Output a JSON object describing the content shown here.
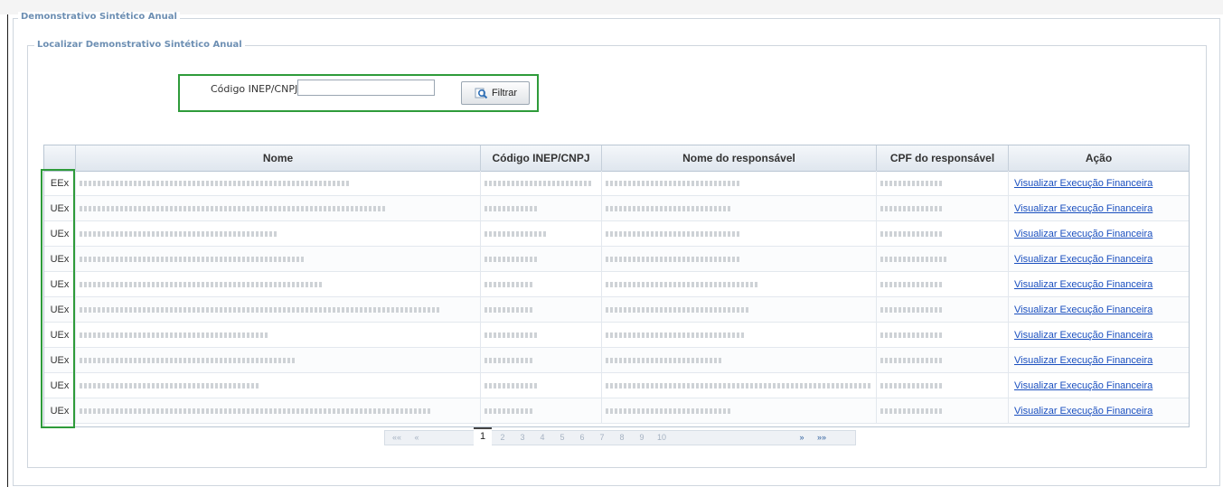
{
  "panel": {
    "title": "Demonstrativo Sintético Anual",
    "section_title": "Localizar Demonstrativo Sintético Anual"
  },
  "filter": {
    "label": "Código INEP/CNPJ",
    "value": "",
    "button_label": "Filtrar"
  },
  "table": {
    "headers": [
      "",
      "Nome",
      "Código INEP/CNPJ",
      "Nome do responsável",
      "CPF do responsável",
      "Ação"
    ],
    "action_label": "Visualizar Execução Financeira",
    "rows": [
      {
        "type": "EEx"
      },
      {
        "type": "UEx"
      },
      {
        "type": "UEx"
      },
      {
        "type": "UEx"
      },
      {
        "type": "UEx"
      },
      {
        "type": "UEx"
      },
      {
        "type": "UEx"
      },
      {
        "type": "UEx"
      },
      {
        "type": "UEx"
      },
      {
        "type": "UEx"
      }
    ]
  },
  "pagination": {
    "current_page": "1",
    "next": "»",
    "last": "»»"
  },
  "colors": {
    "highlight": "#2e9b3a",
    "link": "#1a4fbf",
    "legend": "#6d8fb3"
  }
}
